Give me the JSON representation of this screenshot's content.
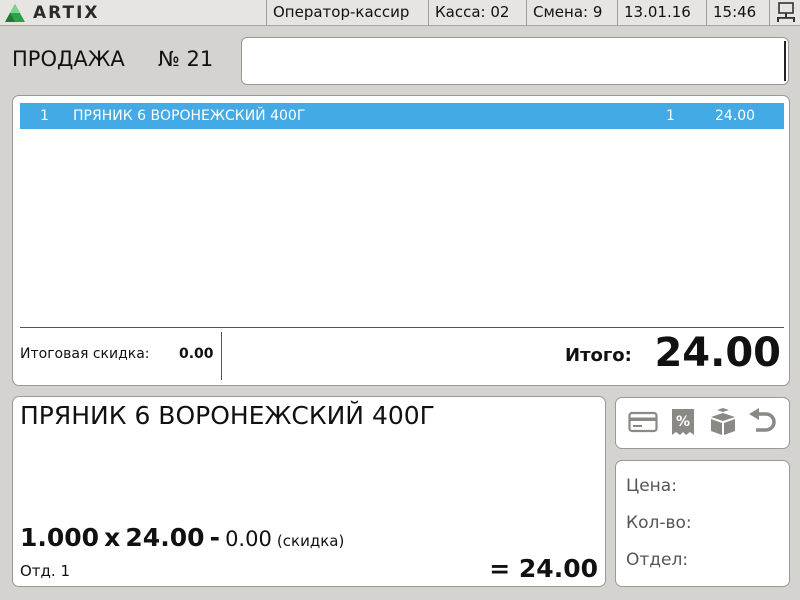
{
  "topbar": {
    "brand": "ARTIX",
    "operator": "Оператор-кассир",
    "register": "Касса: 02",
    "shift": "Смена: 9",
    "date": "13.01.16",
    "time": "15:46",
    "icons": [
      "artix-logo-icon",
      "network-icon"
    ]
  },
  "header": {
    "mode": "ПРОДАЖА",
    "number": "№ 21",
    "search_value": ""
  },
  "receipt": {
    "rows": [
      {
        "index": "1",
        "name": "ПРЯНИК 6 ВОРОНЕЖСКИЙ 400Г",
        "qty": "1",
        "sum": "24.00",
        "selected": true
      }
    ],
    "discount_label": "Итоговая скидка:",
    "discount_value": "0.00",
    "total_label": "Итого:",
    "total_value": "24.00"
  },
  "item": {
    "name": "ПРЯНИК 6 ВОРОНЕЖСКИЙ 400Г",
    "qty": "1.000",
    "times": "x",
    "price": "24.00",
    "minus": "-",
    "discount": "0.00",
    "discount_label": "(скидка)",
    "dept": "Отд. 1",
    "line_total": "= 24.00"
  },
  "actions": {
    "icons": [
      "card-payment-icon",
      "discount-icon",
      "boxes-icon",
      "undo-icon"
    ]
  },
  "info": {
    "price_label": "Цена:",
    "qty_label": "Кол-во:",
    "dept_label": "Отдел:"
  },
  "colors": {
    "accent": "#44aae6",
    "logo_green": "#2aa34a",
    "icon_grey": "#8a8986"
  }
}
